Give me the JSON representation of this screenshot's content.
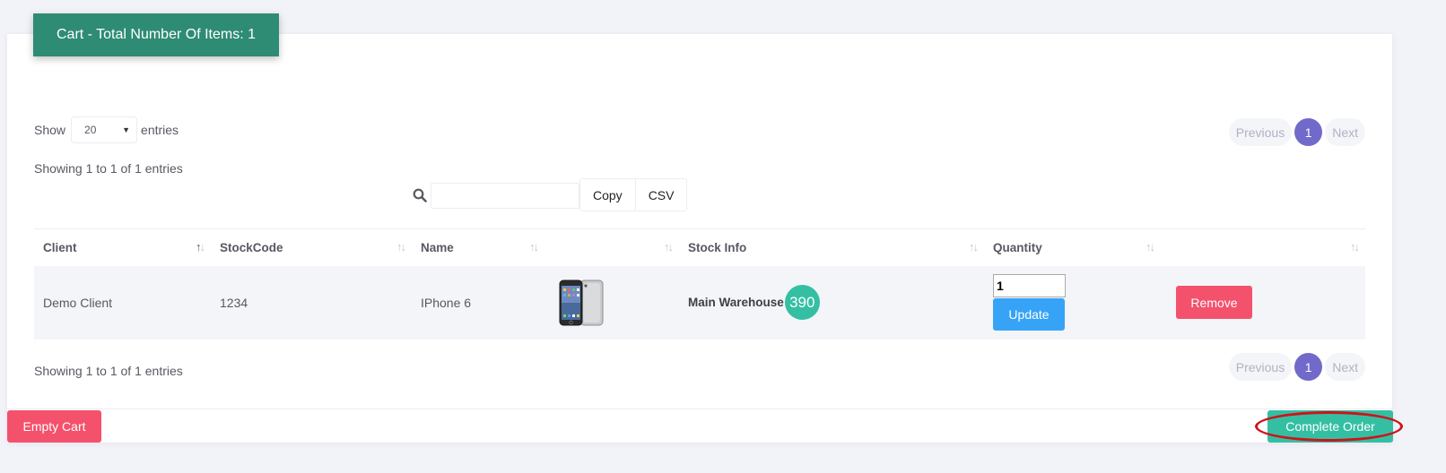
{
  "cart": {
    "title": "Cart - Total Number Of Items: 1"
  },
  "length_menu": {
    "show_label": "Show",
    "value": "20",
    "entries_label": "entries"
  },
  "info": {
    "top": "Showing 1 to 1 of 1 entries",
    "bottom": "Showing 1 to 1 of 1 entries"
  },
  "search": {
    "value": ""
  },
  "export_buttons": {
    "copy": "Copy",
    "csv": "CSV"
  },
  "pagination": {
    "previous": "Previous",
    "current": "1",
    "next": "Next"
  },
  "table": {
    "headers": {
      "client": "Client",
      "stockcode": "StockCode",
      "name": "Name",
      "image": "",
      "stock_info": "Stock Info",
      "quantity": "Quantity",
      "action": ""
    },
    "rows": [
      {
        "client": "Demo Client",
        "stockcode": "1234",
        "name": "IPhone 6",
        "image_icon": "iphone-6-product-image",
        "warehouse": "Main Warehouse",
        "stock_count": "390",
        "quantity": "1",
        "update_label": "Update",
        "remove_label": "Remove"
      }
    ]
  },
  "footer": {
    "empty_cart": "Empty Cart",
    "complete_order": "Complete Order"
  },
  "colors": {
    "header_green": "#2e8b74",
    "brand_purple": "#716aca",
    "success": "#34bfa3",
    "danger": "#f4516c",
    "info": "#36a3f7",
    "annotation_red": "#d0121b"
  }
}
